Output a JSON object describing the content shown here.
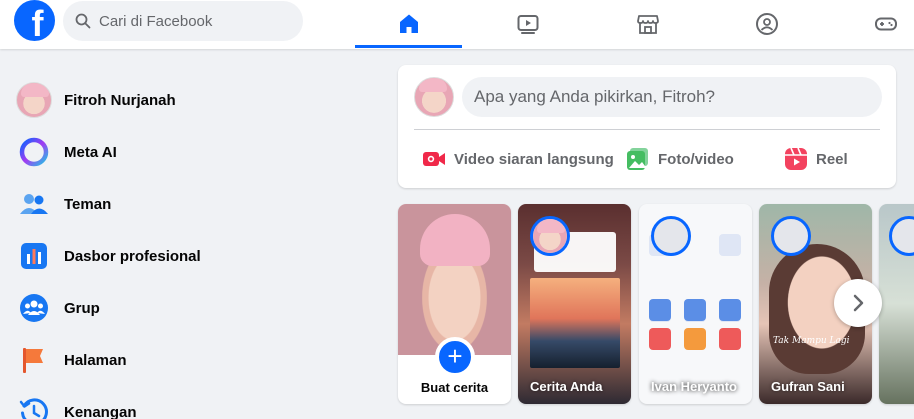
{
  "search": {
    "placeholder": "Cari di Facebook"
  },
  "nav": {
    "tabs": [
      {
        "name": "home",
        "icon": "home-icon",
        "active": true
      },
      {
        "name": "video",
        "icon": "video-icon",
        "active": false
      },
      {
        "name": "marketplace",
        "icon": "marketplace-icon",
        "active": false
      },
      {
        "name": "groups",
        "icon": "groups-icon",
        "active": false
      },
      {
        "name": "gaming",
        "icon": "gaming-icon",
        "active": false
      }
    ]
  },
  "sidebar": {
    "items": [
      {
        "label": "Fitroh Nurjanah",
        "icon": "profile-avatar"
      },
      {
        "label": "Meta AI",
        "icon": "meta-ai-icon"
      },
      {
        "label": "Teman",
        "icon": "friends-icon"
      },
      {
        "label": "Dasbor profesional",
        "icon": "dashboard-icon"
      },
      {
        "label": "Grup",
        "icon": "groups-icon"
      },
      {
        "label": "Halaman",
        "icon": "pages-flag-icon"
      },
      {
        "label": "Kenangan",
        "icon": "memories-clock-icon"
      }
    ]
  },
  "composer": {
    "placeholder": "Apa yang Anda pikirkan, Fitroh?",
    "actions": [
      {
        "label": "Video siaran langsung",
        "icon": "live-video-icon",
        "color": "#f02849"
      },
      {
        "label": "Foto/video",
        "icon": "photo-icon",
        "color": "#45bd62"
      },
      {
        "label": "Reel",
        "icon": "reel-icon",
        "color": "#f3425f"
      }
    ]
  },
  "stories": {
    "create_label": "Buat cerita",
    "items": [
      {
        "name": "Cerita Anda"
      },
      {
        "name": "Ivan Heryanto"
      },
      {
        "name": "Gufran Sani"
      }
    ],
    "gufran_caption": "Tak Mampu Lagi"
  },
  "colors": {
    "brand": "#0866ff",
    "background": "#f0f2f5"
  }
}
